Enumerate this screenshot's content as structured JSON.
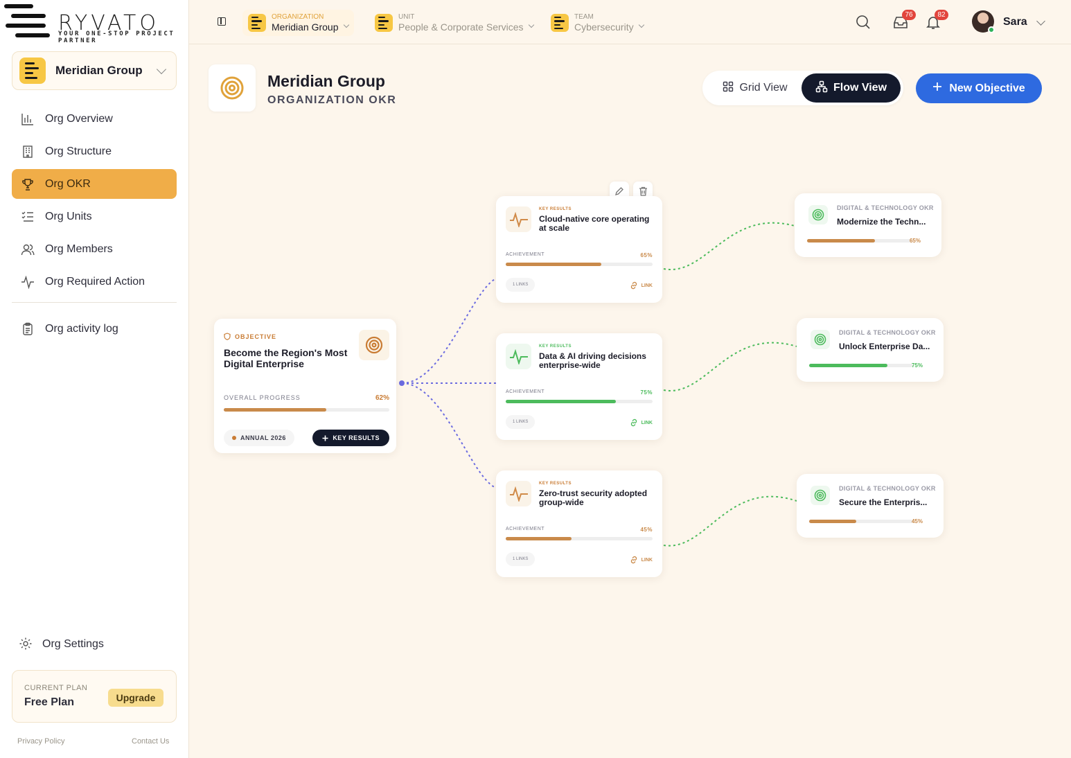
{
  "brand": {
    "name": "RYVATO",
    "tagline": "YOUR ONE-STOP PROJECT PARTNER"
  },
  "sidebar": {
    "org_name": "Meridian Group",
    "items": [
      {
        "label": "Org Overview",
        "icon": "bar-chart-icon",
        "active": false
      },
      {
        "label": "Org Structure",
        "icon": "building-icon",
        "active": false
      },
      {
        "label": "Org OKR",
        "icon": "trophy-icon",
        "active": true
      },
      {
        "label": "Org Units",
        "icon": "list-check-icon",
        "active": false
      },
      {
        "label": "Org Members",
        "icon": "users-icon",
        "active": false
      },
      {
        "label": "Org Required Action",
        "icon": "activity-icon",
        "active": false
      }
    ],
    "activity_log": "Org activity log",
    "settings": "Org Settings",
    "plan": {
      "label": "CURRENT PLAN",
      "value": "Free Plan",
      "upgrade": "Upgrade"
    },
    "footer": {
      "privacy": "Privacy Policy",
      "contact": "Contact Us"
    }
  },
  "topbar": {
    "crumbs": [
      {
        "key": "ORGANIZATION",
        "value": "Meridian Group"
      },
      {
        "key": "UNIT",
        "value": "People & Corporate Services"
      },
      {
        "key": "TEAM",
        "value": "Cybersecurity"
      }
    ],
    "inbox_count": "76",
    "notifications_count": "82",
    "user": "Sara"
  },
  "page": {
    "title": "Meridian Group",
    "subtitle": "ORGANIZATION OKR",
    "grid_view": "Grid View",
    "flow_view": "Flow View",
    "new_objective": "New Objective"
  },
  "objective": {
    "kicker": "OBJECTIVE",
    "title": "Become the Region's Most Digital Enterprise",
    "progress_label": "OVERALL PROGRESS",
    "progress": "62%",
    "progress_value": 62,
    "period": "ANNUAL 2026",
    "key_results_btn": "KEY RESULTS"
  },
  "key_results": [
    {
      "kicker": "KEY RESULTS",
      "title": "Cloud-native core operating at scale",
      "achievement_label": "ACHIEVEMENT",
      "achievement": "65%",
      "value": 65,
      "links": "1 LINKS",
      "link": "LINK",
      "color": "#c98a4a"
    },
    {
      "kicker": "KEY RESULTS",
      "title": "Data & AI driving decisions enterprise-wide",
      "achievement_label": "ACHIEVEMENT",
      "achievement": "75%",
      "value": 75,
      "links": "1 LINKS",
      "link": "LINK",
      "color": "#4cbb5c"
    },
    {
      "kicker": "KEY RESULTS",
      "title": "Zero-trust security adopted group-wide",
      "achievement_label": "ACHIEVEMENT",
      "achievement": "45%",
      "value": 45,
      "links": "1 LINKS",
      "link": "LINK",
      "color": "#c98a4a"
    }
  ],
  "linked_okrs": [
    {
      "kicker": "DIGITAL & TECHNOLOGY OKR",
      "title": "Modernize the Techn...",
      "pct": "65%",
      "value": 65,
      "color": "#c98a4a"
    },
    {
      "kicker": "DIGITAL & TECHNOLOGY OKR",
      "title": "Unlock Enterprise Da...",
      "pct": "75%",
      "value": 75,
      "color": "#4cbb5c"
    },
    {
      "kicker": "DIGITAL & TECHNOLOGY OKR",
      "title": "Secure the Enterpris...",
      "pct": "45%",
      "value": 45,
      "color": "#c98a4a"
    }
  ],
  "colors": {
    "accent": "#f0ad48",
    "primary": "#2e6ae0",
    "dark": "#141a2c",
    "connector_objective": "#6b6be0",
    "connector_okr": "#4cbb5c"
  }
}
